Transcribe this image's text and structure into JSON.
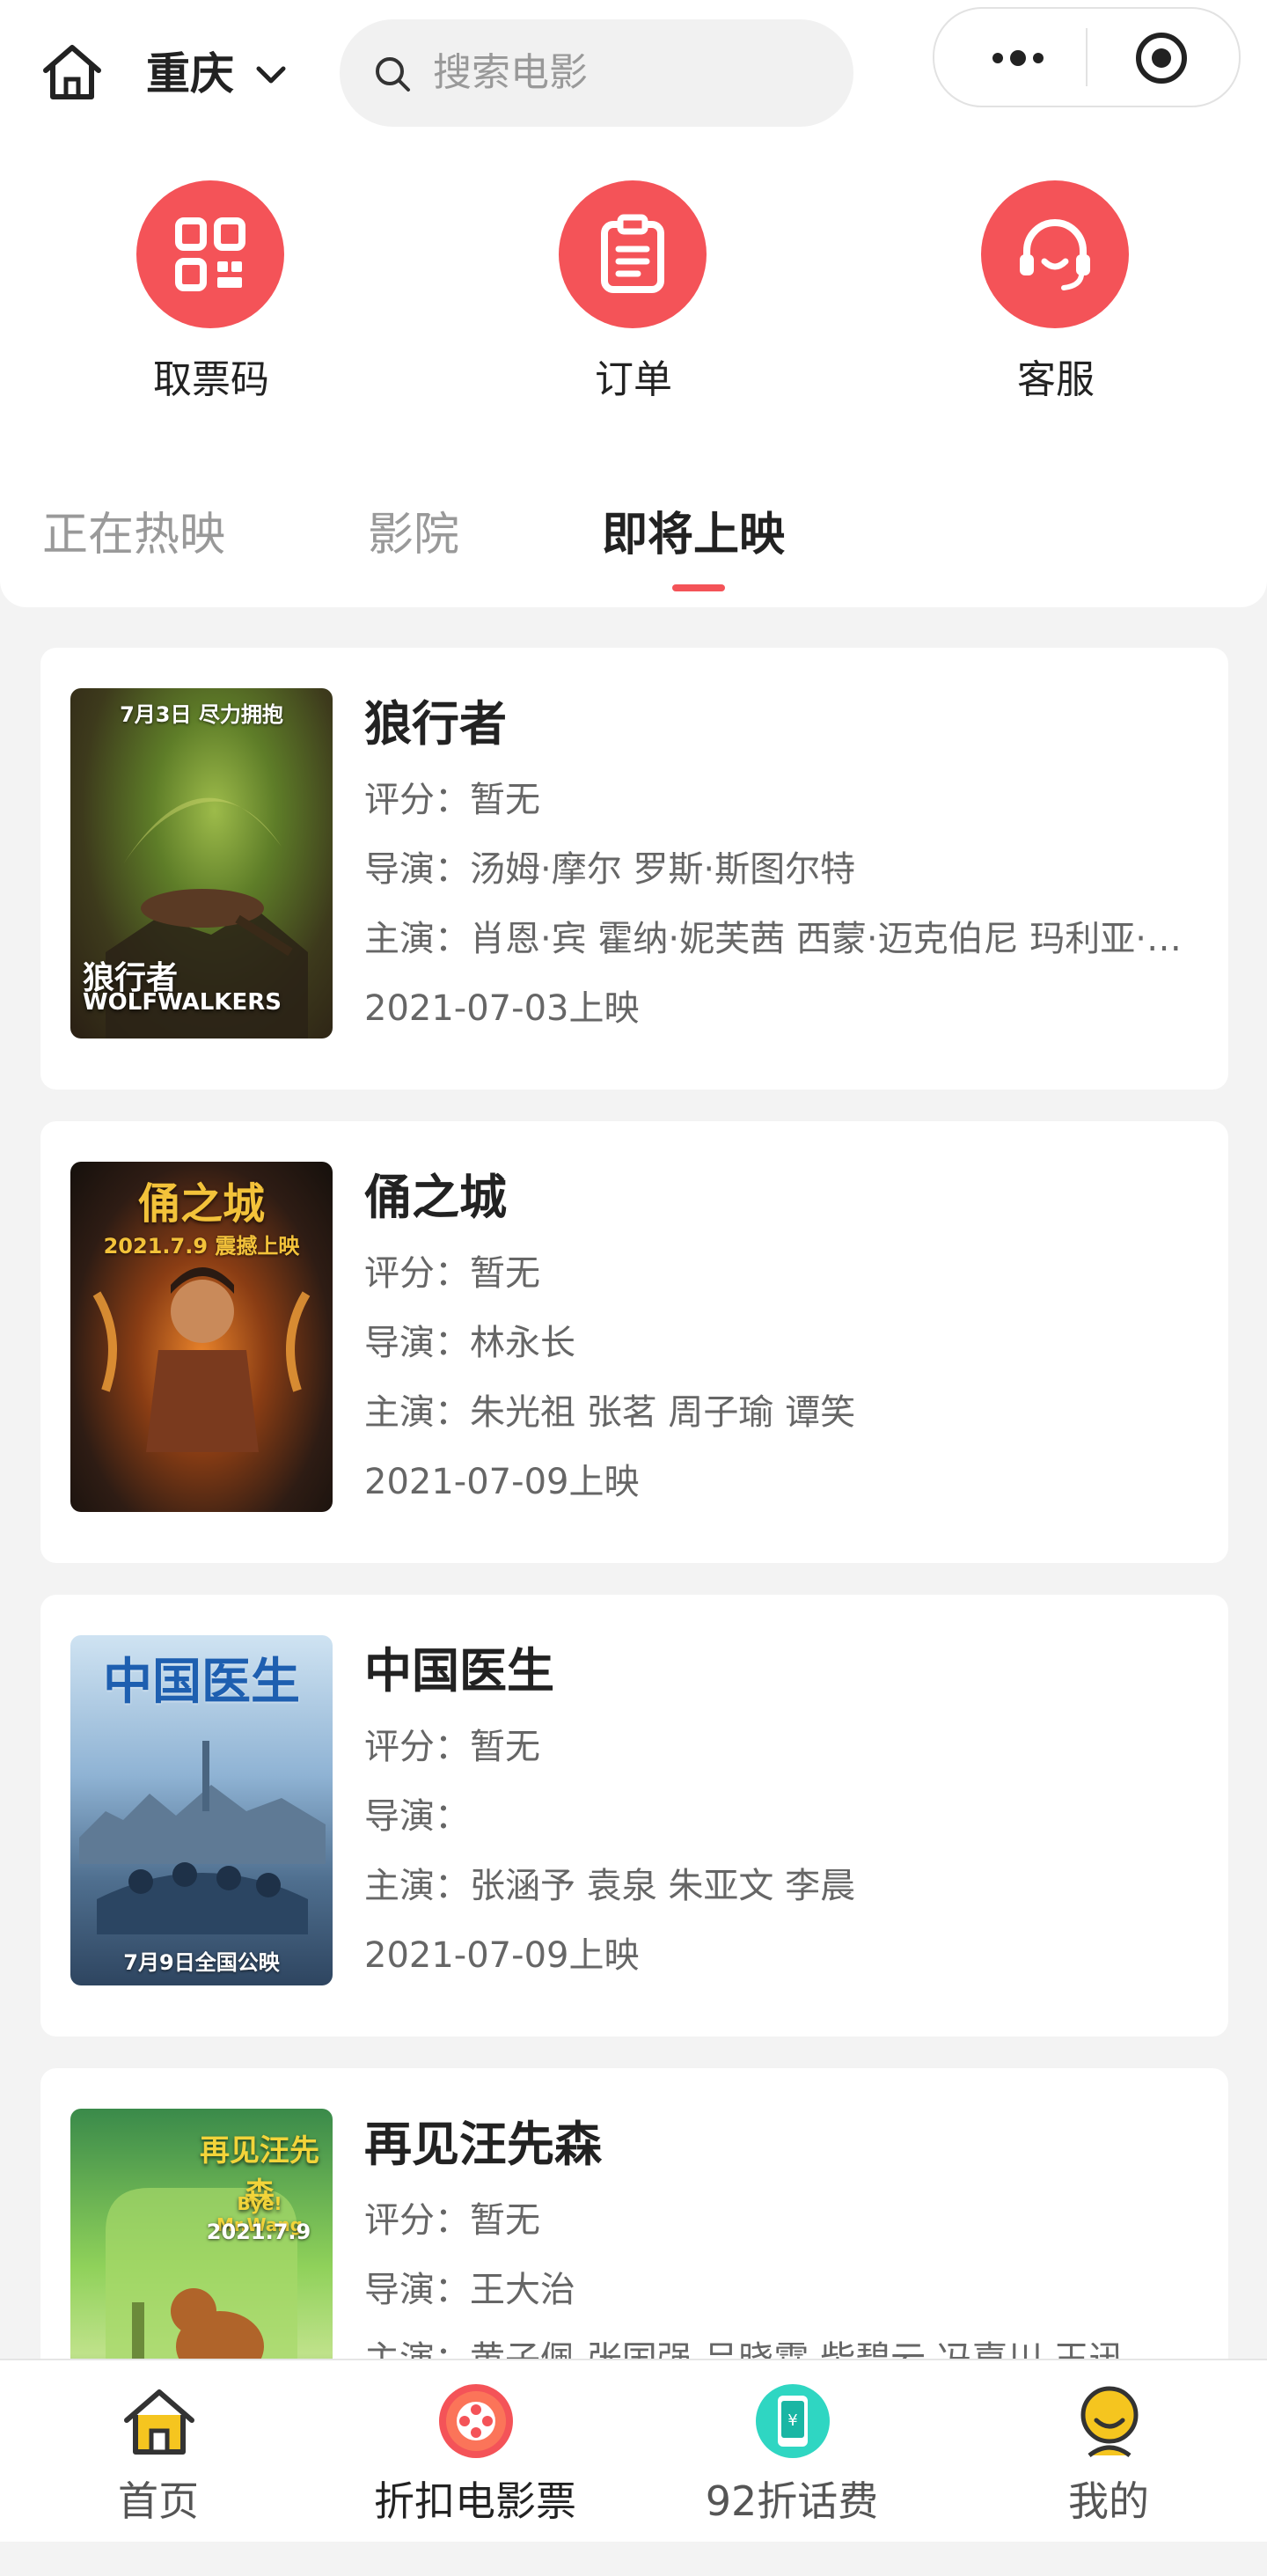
{
  "header": {
    "city": "重庆",
    "search_placeholder": "搜索电影"
  },
  "quick_actions": [
    {
      "label": "取票码",
      "icon": "qr-code-icon"
    },
    {
      "label": "订单",
      "icon": "clipboard-icon"
    },
    {
      "label": "客服",
      "icon": "headset-icon"
    }
  ],
  "tabs": [
    {
      "label": "正在热映",
      "active": false
    },
    {
      "label": "影院",
      "active": false
    },
    {
      "label": "即将上映",
      "active": true
    }
  ],
  "movies": [
    {
      "title": "狼行者",
      "rating": "评分：暂无",
      "director": "导演：汤姆·摩尔 罗斯·斯图尔特",
      "cast": "主演：肖恩·宾 霍纳·妮芙茜 西蒙·迈克伯尼 玛利亚·多伊尔·肯尼迪",
      "release": "2021-07-03上映",
      "poster_title": "狼行者",
      "poster_sub": "WOLFWALKERS",
      "poster_date": "7月3日 尽力拥抱"
    },
    {
      "title": "俑之城",
      "rating": "评分：暂无",
      "director": "导演：林永长",
      "cast": "主演：朱光祖 张茗 周子瑜 谭笑",
      "release": "2021-07-09上映",
      "poster_title": "俑之城",
      "poster_sub": "",
      "poster_date": "2021.7.9 震撼上映"
    },
    {
      "title": "中国医生",
      "rating": "评分：暂无",
      "director": "导演：",
      "cast": "主演：张涵予 袁泉 朱亚文 李晨",
      "release": "2021-07-09上映",
      "poster_title": "中国医生",
      "poster_sub": "",
      "poster_date": "7月9日全国公映"
    },
    {
      "title": "再见汪先森",
      "rating": "评分：暂无",
      "director": "导演：王大治",
      "cast": "主演：黄子佩 张国强 吕晓霖 柴碧云 冯嘉川 王迅",
      "release": "",
      "poster_title": "再见汪先森",
      "poster_sub": "Bye! Mr.Wang",
      "poster_date": "2021.7.9"
    }
  ],
  "bottom_nav": [
    {
      "label": "首页",
      "icon": "home-icon"
    },
    {
      "label": "折扣电影票",
      "icon": "film-reel-icon"
    },
    {
      "label": "92折话费",
      "icon": "phone-bill-icon"
    },
    {
      "label": "我的",
      "icon": "profile-icon"
    }
  ],
  "colors": {
    "accent": "#f45358",
    "background": "#f3f3f3"
  }
}
